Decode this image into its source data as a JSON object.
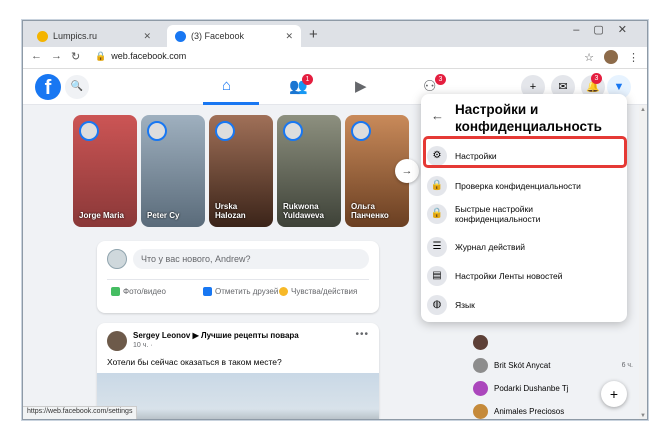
{
  "browser": {
    "tabs": [
      {
        "label": "Lumpics.ru",
        "active": false,
        "favicon_color": "#f4b400"
      },
      {
        "label": "(3) Facebook",
        "active": true,
        "favicon_color": "#1877f2"
      }
    ],
    "url": "web.facebook.com",
    "status_url": "https://web.facebook.com/settings"
  },
  "facebook": {
    "accent": "#1877f2",
    "friends_badge": "1",
    "groups_badge": "3",
    "notifications_badge": "3"
  },
  "stories": [
    {
      "name": "Jorge Maria",
      "bg": "#b0464a"
    },
    {
      "name": "Peter Cy",
      "bg": "#7a8a99"
    },
    {
      "name": "Urska Halozan",
      "bg": "#5e3a2c"
    },
    {
      "name": "Rukwona Yuldaweva",
      "bg": "#6b6f63"
    },
    {
      "name": "Ольга Панченко",
      "bg": "#8a5a3a"
    }
  ],
  "composer": {
    "placeholder": "Что у вас нового, Andrew?",
    "actions": [
      "Фото/видео",
      "Отметить друзей",
      "Чувства/действия"
    ]
  },
  "post": {
    "author": "Sergey Leonov ▶ Лучшие рецепты повара",
    "time": "10 ч. · ",
    "text": "Хотели бы сейчас оказаться в таком месте?"
  },
  "contacts": [
    {
      "name": "",
      "time": "",
      "color": "#5d4037"
    },
    {
      "name": "Brit Skót Anycat",
      "time": "6 ч.",
      "color": "#8d8d8d"
    },
    {
      "name": "Podarki Dushanbe Tj",
      "time": "",
      "color": "#ab47bc"
    },
    {
      "name": "Animales Preciosos",
      "time": "",
      "color": "#c58a3a"
    }
  ],
  "menu": {
    "title": "Настройки и конфиденциальность",
    "items": [
      {
        "label": "Настройки",
        "icon": "gear-icon",
        "glyph": "⚙"
      },
      {
        "label": "Проверка конфиденциальности",
        "icon": "lock-check-icon",
        "glyph": "🔒"
      },
      {
        "label": "Быстрые настройки конфиденциальности",
        "icon": "lock-icon",
        "glyph": "🔒"
      },
      {
        "label": "Журнал действий",
        "icon": "list-icon",
        "glyph": "☰"
      },
      {
        "label": "Настройки Ленты новостей",
        "icon": "news-feed-icon",
        "glyph": "▤"
      },
      {
        "label": "Язык",
        "icon": "globe-icon",
        "glyph": "◍"
      }
    ]
  }
}
